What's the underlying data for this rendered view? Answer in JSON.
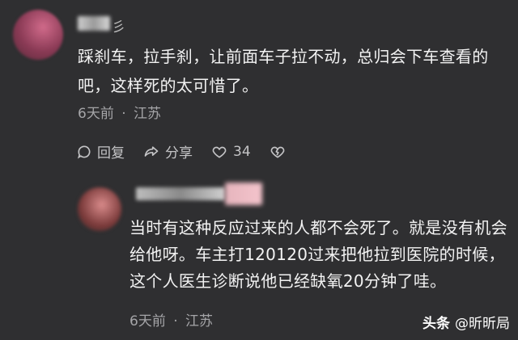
{
  "main_comment": {
    "username_tail": "彡",
    "text": "踩刹车，拉手刹，让前面车子拉不动，总归会下车查看的吧，这样死的太可惜了。",
    "time": "6天前",
    "location": "江苏",
    "separator": "·",
    "actions": {
      "reply_label": "回复",
      "share_label": "分享",
      "like_count": "34"
    }
  },
  "reply_comment": {
    "text": "当时有这种反应过来的人都不会死了。就是没有机会给他呀。车主打120120过来把他拉到医院的时候，这个人医生诊断说他已经缺氧20分钟了哇。",
    "time": "6天前",
    "location": "江苏",
    "separator": "·"
  },
  "watermark": {
    "brand": "头条",
    "handle": "@昕昕局"
  },
  "colors": {
    "background": "#2f2f31",
    "text_primary": "#f3f3f3",
    "text_secondary": "#a5a5a8"
  }
}
